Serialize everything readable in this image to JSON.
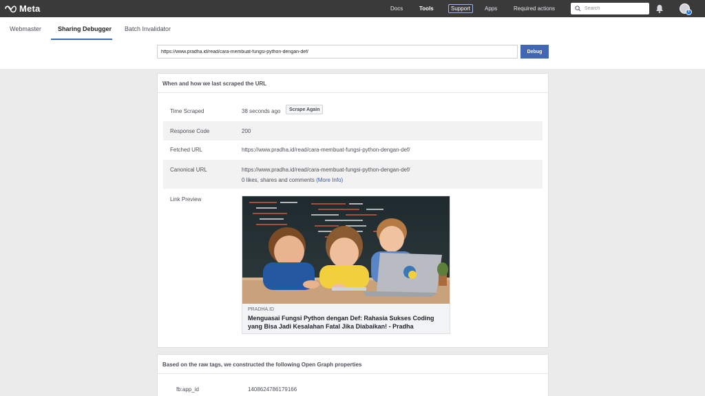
{
  "topbar": {
    "brand": "Meta",
    "nav": [
      "Docs",
      "Tools",
      "Support",
      "Apps",
      "Required actions"
    ],
    "search_placeholder": "Search"
  },
  "tabs": [
    {
      "label": "Webmaster"
    },
    {
      "label": "Sharing Debugger",
      "active": true
    },
    {
      "label": "Batch Invalidator"
    }
  ],
  "debug": {
    "url": "https://www.pradha.id/read/cara-membuat-fungsi-python-dengan-def/",
    "button": "Debug"
  },
  "scrape_panel": {
    "heading": "When and how we last scraped the URL",
    "time_scraped_label": "Time Scraped",
    "time_scraped_value": "38 seconds ago",
    "scrape_again": "Scrape Again",
    "response_code_label": "Response Code",
    "response_code_value": "200",
    "fetched_url_label": "Fetched URL",
    "fetched_url_value": "https://www.pradha.id/read/cara-membuat-fungsi-python-dengan-def/",
    "canonical_url_label": "Canonical URL",
    "canonical_url_value": "https://www.pradha.id/read/cara-membuat-fungsi-python-dengan-def/",
    "engagement_text": "0 likes, shares and comments",
    "more_info": "(More Info)",
    "link_preview_label": "Link Preview",
    "preview_domain": "PRADHA.ID",
    "preview_title": "Menguasai Fungsi Python dengan Def: Rahasia Sukses Coding yang Bisa Jadi Kesalahan Fatal Jika Diabaikan! - Pradha"
  },
  "og_panel": {
    "heading": "Based on the raw tags, we constructed the following Open Graph properties",
    "app_id_label": "fb:app_id",
    "app_id_value": "1408624786179166"
  },
  "colors": {
    "topbar": "#3a3a3a",
    "accent": "#4267b2",
    "link": "#365899"
  }
}
